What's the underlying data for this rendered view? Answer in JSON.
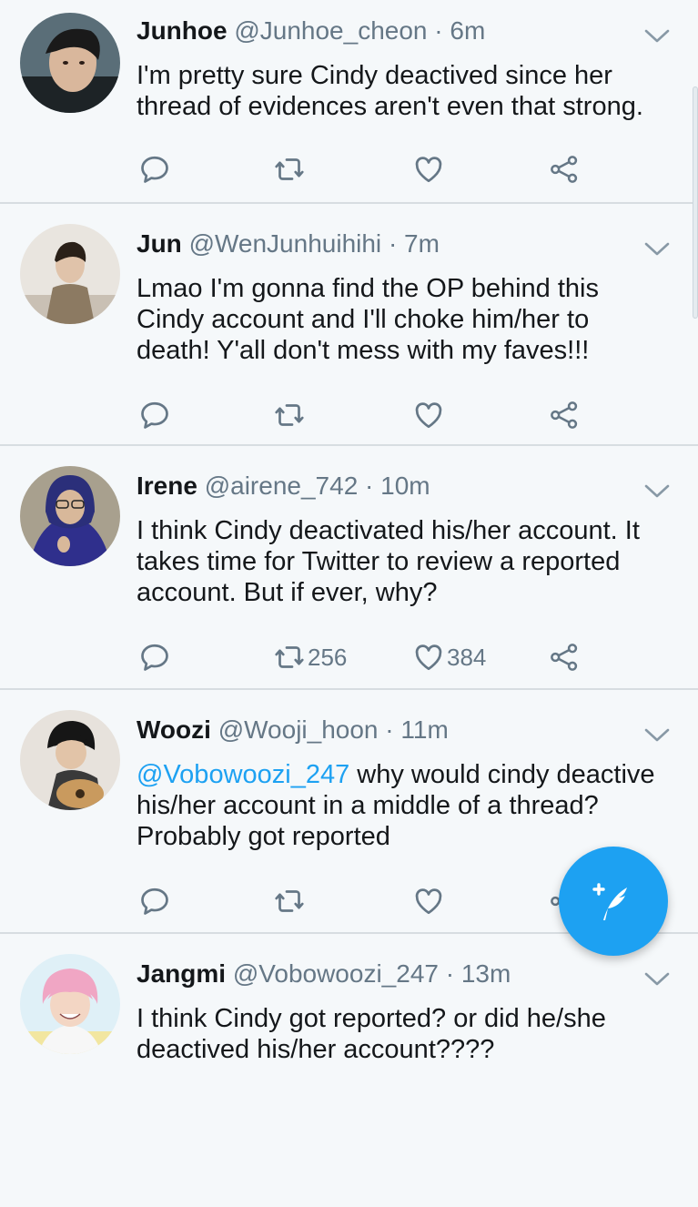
{
  "tweets": [
    {
      "name": "Junhoe",
      "handle": "@Junhoe_cheon",
      "separator": "·",
      "time": "6m",
      "lines": [
        "I'm pretty sure Cindy deactived since her",
        "thread of evidences aren't even that strong."
      ],
      "retweets": "",
      "likes": ""
    },
    {
      "name": "Jun",
      "handle": "@WenJunhuihihi",
      "separator": "·",
      "time": "7m",
      "lines": [
        "Lmao I'm gonna find the OP behind this",
        "Cindy account and I'll choke him/her to",
        "death! Y'all don't mess with my faves!!!"
      ],
      "retweets": "",
      "likes": ""
    },
    {
      "name": "Irene",
      "handle": "@airene_742",
      "separator": "·",
      "time": "10m",
      "lines": [
        "I think Cindy deactivated his/her account. It",
        "takes time for Twitter to review a reported",
        "account. But if ever, why?"
      ],
      "retweets": "256",
      "likes": "384"
    },
    {
      "name": "Woozi",
      "handle": "@Wooji_hoon",
      "separator": "·",
      "time": "11m",
      "mention": "@Vobowoozi_247",
      "line1_rest": " why would cindy deactive",
      "lines": [
        "his/her account in a middle of a thread?",
        "Probably got reported"
      ],
      "retweets": "",
      "likes": ""
    },
    {
      "name": "Jangmi",
      "handle": "@Vobowoozi_247",
      "separator": "·",
      "time": "13m",
      "lines": [
        "I think Cindy got reported? or did he/she",
        "deactived his/her account????"
      ],
      "retweets": "",
      "likes": ""
    }
  ],
  "icons": {
    "reply": "reply-icon",
    "retweet": "retweet-icon",
    "like": "heart-icon",
    "share": "share-icon",
    "menu": "chevron-down-icon",
    "compose": "compose-tweet-icon"
  },
  "colors": {
    "accent": "#1da1f2",
    "muted": "#657786",
    "background": "#f5f8fa",
    "divider": "#d7dde1"
  }
}
